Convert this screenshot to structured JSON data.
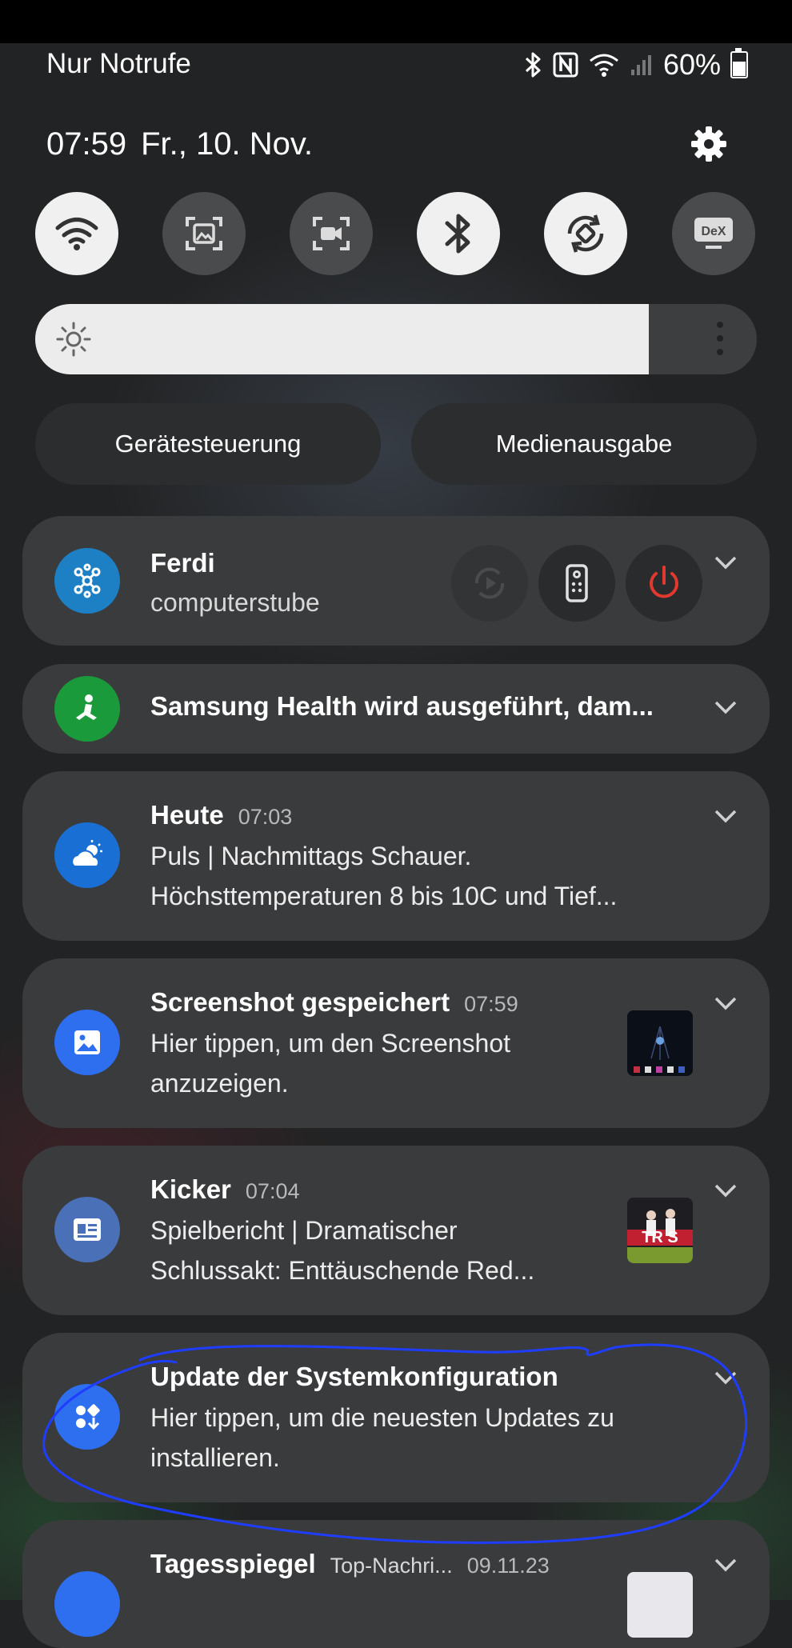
{
  "status_bar": {
    "carrier_text": "Nur Notrufe",
    "battery": "60%",
    "battery_level": 0.6
  },
  "header": {
    "time": "07:59",
    "date": "Fr., 10. Nov."
  },
  "quick_settings": [
    {
      "name": "wifi-icon",
      "state": "on"
    },
    {
      "name": "screenshot-icon",
      "state": "off"
    },
    {
      "name": "screen-recorder-icon",
      "state": "off"
    },
    {
      "name": "bluetooth-icon",
      "state": "on"
    },
    {
      "name": "auto-rotate-icon",
      "state": "on"
    },
    {
      "name": "dex-icon",
      "label": "DeX",
      "state": "off"
    }
  ],
  "brightness": {
    "level": 0.85
  },
  "buttons": {
    "device_control": "Gerätesteuerung",
    "media_output": "Medienausgabe"
  },
  "notifications": [
    {
      "app": "Ferdi",
      "subtitle": "computerstube",
      "icon": "smartthings-icon",
      "color": "#1d7fc4"
    },
    {
      "title": "Samsung Health wird ausgeführt, dam...",
      "icon": "samsung-health-icon",
      "color": "#1a9a3a"
    },
    {
      "app": "Heute",
      "time": "07:03",
      "line1": "Puls | Nachmittags Schauer.",
      "line2": "Höchsttemperaturen 8 bis 10C und Tief...",
      "icon": "weather-icon",
      "color": "#1a6fd4"
    },
    {
      "app": "Screenshot gespeichert",
      "time": "07:59",
      "line1": "Hier tippen, um den Screenshot",
      "line2": "anzuzeigen.",
      "icon": "image-icon",
      "color": "#2e6ff0"
    },
    {
      "app": "Kicker",
      "time": "07:04",
      "line1": "Spielbericht | Dramatischer",
      "line2": "Schlussakt: Enttäuschende Red...",
      "icon": "news-icon",
      "color": "#4a70b8",
      "thumb_text": "TR S"
    },
    {
      "app": "Update der Systemkonfiguration",
      "line1": "Hier tippen, um die neuesten Updates zu",
      "line2": "installieren.",
      "icon": "update-icon",
      "color": "#2e6ff0"
    },
    {
      "app": "Tagesspiegel",
      "category": "Top-Nachri...",
      "time": "09.11.23",
      "icon": "tagesspiegel-icon",
      "color": "#2e6ff0"
    }
  ],
  "colors": {
    "accent_blue": "#2e6ff0",
    "annotation": "#1f3dff",
    "power_red": "#e0392f",
    "card_bg": "#3a3b3d"
  }
}
